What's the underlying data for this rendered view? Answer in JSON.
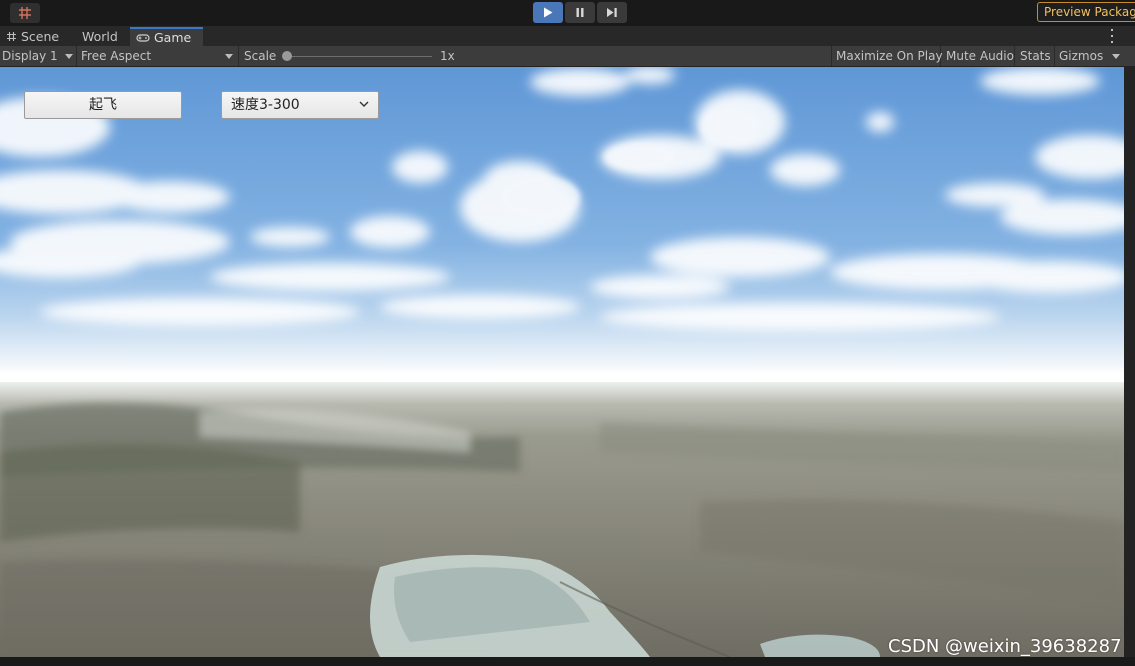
{
  "toolbar": {
    "tool_icon": "grid-snap-icon",
    "play_controls": [
      {
        "icon": "play-icon",
        "active": true
      },
      {
        "icon": "pause-icon",
        "active": false
      },
      {
        "icon": "step-icon",
        "active": false
      }
    ],
    "preview_label": "Preview Packag"
  },
  "tabs": [
    {
      "label": "Scene",
      "icon": "hash-icon",
      "active": false
    },
    {
      "label": "World",
      "icon": "",
      "active": false
    },
    {
      "label": "Game",
      "icon": "gamepad-icon",
      "active": true
    }
  ],
  "game_bar": {
    "display": "Display 1",
    "aspect": "Free Aspect",
    "scale_label": "Scale",
    "scale_value": "1x",
    "scale_level": 0.0,
    "maximize": "Maximize On Play",
    "mute": "Mute Audio",
    "stats": "Stats",
    "gizmos": "Gizmos"
  },
  "game_ui": {
    "takeoff_label": "起飞",
    "speed_selected": "速度3-300"
  },
  "watermark": "CSDN @weixin_39638287",
  "colors": {
    "play_active": "#4a77b8",
    "tab_accent": "#3a79c9",
    "preview_border": "#c98c2a",
    "sky": "#83b2e2",
    "ground": "#8d8c80"
  }
}
